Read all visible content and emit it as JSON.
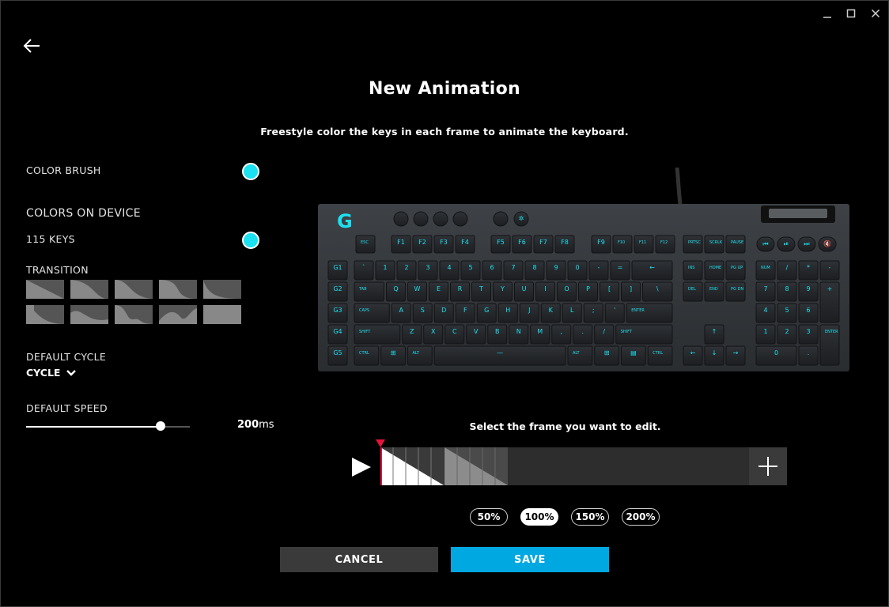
{
  "window": {
    "controls": [
      "minimize-icon",
      "maximize-icon",
      "close-icon"
    ]
  },
  "header": {
    "back_icon": "arrow-left-icon",
    "title": "New Animation",
    "subtitle": "Freestyle color the keys in each frame to animate the keyboard."
  },
  "left_panel": {
    "color_brush_label": "COLOR BRUSH",
    "color_brush_color": "#1ce1f0",
    "colors_on_device_label": "COLORS ON DEVICE",
    "keys_count_label": "115 KEYS",
    "keys_color": "#1ce1f0",
    "transition_label": "TRANSITION",
    "default_cycle_label": "DEFAULT CYCLE",
    "cycle_value": "CYCLE",
    "default_speed_label": "DEFAULT SPEED",
    "speed_value": "200",
    "speed_unit": "ms",
    "speed_slider_fraction": 0.82
  },
  "keyboard": {
    "rows": [
      [
        "ESC",
        "F1",
        "F2",
        "F3",
        "F4",
        "F5",
        "F6",
        "F7",
        "F8",
        "F9",
        "F10",
        "F11",
        "F12"
      ],
      [
        "`",
        "1",
        "2",
        "3",
        "4",
        "5",
        "6",
        "7",
        "8",
        "9",
        "0",
        "-",
        "=",
        "←"
      ],
      [
        "TAB",
        "Q",
        "W",
        "E",
        "R",
        "T",
        "Y",
        "U",
        "I",
        "O",
        "P",
        "[",
        "]",
        "\\"
      ],
      [
        "CAPS",
        "A",
        "S",
        "D",
        "F",
        "G",
        "H",
        "J",
        "K",
        "L",
        ";",
        "'",
        "ENTER"
      ],
      [
        "SHIFT",
        "Z",
        "X",
        "C",
        "V",
        "B",
        "N",
        "M",
        ",",
        ".",
        "/",
        "SHIFT"
      ],
      [
        "CTRL",
        "⊞",
        "ALT",
        "—",
        "ALT",
        "⊞",
        "▤",
        "CTRL"
      ]
    ],
    "g_keys": [
      "G1",
      "G2",
      "G3",
      "G4",
      "G5"
    ],
    "nav_top": [
      "PRTSC",
      "SCRLK",
      "PAUSE"
    ],
    "nav_mid": [
      [
        "INS",
        "HOME",
        "PG UP"
      ],
      [
        "DEL",
        "END",
        "PG DN"
      ]
    ],
    "arrows": [
      "↑",
      "←",
      "↓",
      "→"
    ],
    "numpad": [
      [
        "NUM",
        "/",
        "*",
        "-"
      ],
      [
        "7",
        "8",
        "9",
        "+"
      ],
      [
        "4",
        "5",
        "6"
      ],
      [
        "1",
        "2",
        "3",
        "ENTER"
      ],
      [
        "0",
        "."
      ]
    ],
    "media": [
      "⏮",
      "⏯",
      "⏭",
      "🔇"
    ],
    "accent_color": "#1ce1f0"
  },
  "timeline": {
    "hint": "Select the frame you want to edit.",
    "play_icon": "play-icon",
    "add_icon": "plus-icon",
    "frame_count": 2
  },
  "zoom": {
    "options": [
      "50%",
      "100%",
      "150%",
      "200%"
    ],
    "selected": "100%"
  },
  "actions": {
    "cancel_label": "CANCEL",
    "save_label": "SAVE",
    "save_color": "#00a8e1"
  }
}
